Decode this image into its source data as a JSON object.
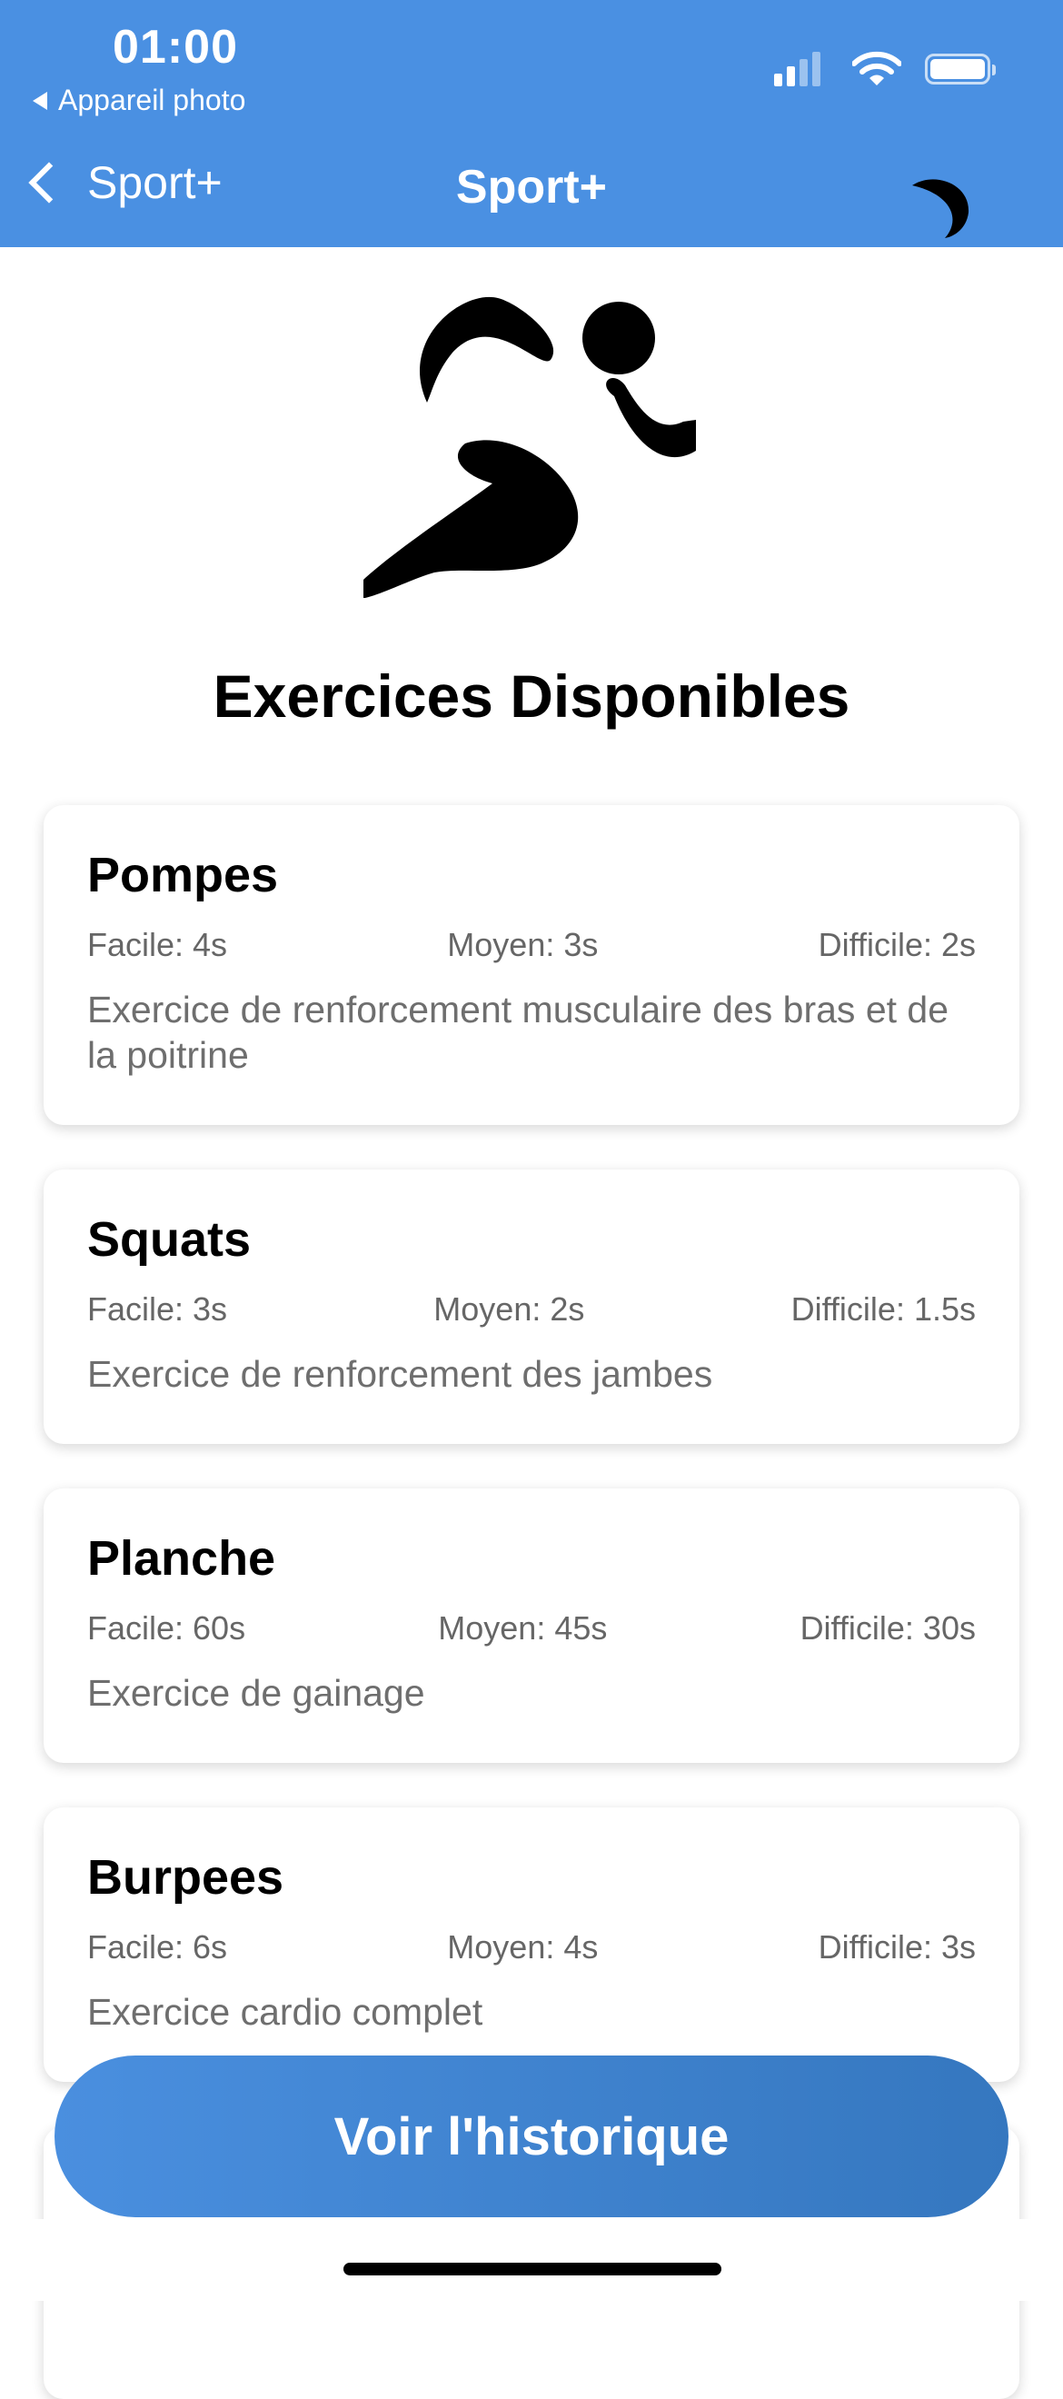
{
  "status_bar": {
    "time": "01:00",
    "back_app": "Appareil photo"
  },
  "nav": {
    "back_label": "Sport+",
    "title": "Sport+"
  },
  "main": {
    "heading": "Exercices Disponibles",
    "exercises": [
      {
        "name": "Pompes",
        "easy": "Facile: 4s",
        "medium": "Moyen: 3s",
        "hard": "Difficile: 2s",
        "description": "Exercice de renforcement musculaire des bras et de la poitrine"
      },
      {
        "name": "Squats",
        "easy": "Facile: 3s",
        "medium": "Moyen: 2s",
        "hard": "Difficile: 1.5s",
        "description": "Exercice de renforcement des jambes"
      },
      {
        "name": "Planche",
        "easy": "Facile: 60s",
        "medium": "Moyen: 45s",
        "hard": "Difficile: 30s",
        "description": "Exercice de gainage"
      },
      {
        "name": "Burpees",
        "easy": "Facile: 6s",
        "medium": "Moyen: 4s",
        "hard": "Difficile: 3s",
        "description": "Exercice cardio complet"
      }
    ],
    "history_button": "Voir l'historique"
  },
  "icons": {
    "signal": "cellular-signal-icon",
    "wifi": "wifi-icon",
    "battery": "battery-icon",
    "theme_toggle": "moon-icon",
    "hero": "runner-icon"
  },
  "colors": {
    "accent": "#4a90e2",
    "button_end": "#3577bf"
  }
}
